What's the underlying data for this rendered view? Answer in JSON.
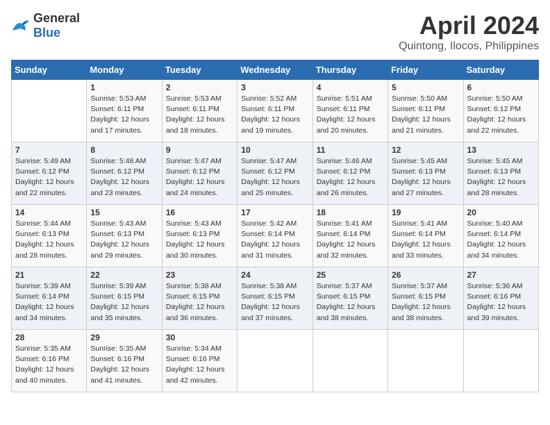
{
  "logo": {
    "general": "General",
    "blue": "Blue"
  },
  "title": "April 2024",
  "subtitle": "Quintong, Ilocos, Philippines",
  "days_of_week": [
    "Sunday",
    "Monday",
    "Tuesday",
    "Wednesday",
    "Thursday",
    "Friday",
    "Saturday"
  ],
  "weeks": [
    [
      {
        "day": "",
        "sunrise": "",
        "sunset": "",
        "daylight": ""
      },
      {
        "day": "1",
        "sunrise": "Sunrise: 5:53 AM",
        "sunset": "Sunset: 6:11 PM",
        "daylight": "Daylight: 12 hours and 17 minutes."
      },
      {
        "day": "2",
        "sunrise": "Sunrise: 5:53 AM",
        "sunset": "Sunset: 6:11 PM",
        "daylight": "Daylight: 12 hours and 18 minutes."
      },
      {
        "day": "3",
        "sunrise": "Sunrise: 5:52 AM",
        "sunset": "Sunset: 6:11 PM",
        "daylight": "Daylight: 12 hours and 19 minutes."
      },
      {
        "day": "4",
        "sunrise": "Sunrise: 5:51 AM",
        "sunset": "Sunset: 6:11 PM",
        "daylight": "Daylight: 12 hours and 20 minutes."
      },
      {
        "day": "5",
        "sunrise": "Sunrise: 5:50 AM",
        "sunset": "Sunset: 6:11 PM",
        "daylight": "Daylight: 12 hours and 21 minutes."
      },
      {
        "day": "6",
        "sunrise": "Sunrise: 5:50 AM",
        "sunset": "Sunset: 6:12 PM",
        "daylight": "Daylight: 12 hours and 22 minutes."
      }
    ],
    [
      {
        "day": "7",
        "sunrise": "Sunrise: 5:49 AM",
        "sunset": "Sunset: 6:12 PM",
        "daylight": "Daylight: 12 hours and 22 minutes."
      },
      {
        "day": "8",
        "sunrise": "Sunrise: 5:48 AM",
        "sunset": "Sunset: 6:12 PM",
        "daylight": "Daylight: 12 hours and 23 minutes."
      },
      {
        "day": "9",
        "sunrise": "Sunrise: 5:47 AM",
        "sunset": "Sunset: 6:12 PM",
        "daylight": "Daylight: 12 hours and 24 minutes."
      },
      {
        "day": "10",
        "sunrise": "Sunrise: 5:47 AM",
        "sunset": "Sunset: 6:12 PM",
        "daylight": "Daylight: 12 hours and 25 minutes."
      },
      {
        "day": "11",
        "sunrise": "Sunrise: 5:46 AM",
        "sunset": "Sunset: 6:12 PM",
        "daylight": "Daylight: 12 hours and 26 minutes."
      },
      {
        "day": "12",
        "sunrise": "Sunrise: 5:45 AM",
        "sunset": "Sunset: 6:13 PM",
        "daylight": "Daylight: 12 hours and 27 minutes."
      },
      {
        "day": "13",
        "sunrise": "Sunrise: 5:45 AM",
        "sunset": "Sunset: 6:13 PM",
        "daylight": "Daylight: 12 hours and 28 minutes."
      }
    ],
    [
      {
        "day": "14",
        "sunrise": "Sunrise: 5:44 AM",
        "sunset": "Sunset: 6:13 PM",
        "daylight": "Daylight: 12 hours and 28 minutes."
      },
      {
        "day": "15",
        "sunrise": "Sunrise: 5:43 AM",
        "sunset": "Sunset: 6:13 PM",
        "daylight": "Daylight: 12 hours and 29 minutes."
      },
      {
        "day": "16",
        "sunrise": "Sunrise: 5:43 AM",
        "sunset": "Sunset: 6:13 PM",
        "daylight": "Daylight: 12 hours and 30 minutes."
      },
      {
        "day": "17",
        "sunrise": "Sunrise: 5:42 AM",
        "sunset": "Sunset: 6:14 PM",
        "daylight": "Daylight: 12 hours and 31 minutes."
      },
      {
        "day": "18",
        "sunrise": "Sunrise: 5:41 AM",
        "sunset": "Sunset: 6:14 PM",
        "daylight": "Daylight: 12 hours and 32 minutes."
      },
      {
        "day": "19",
        "sunrise": "Sunrise: 5:41 AM",
        "sunset": "Sunset: 6:14 PM",
        "daylight": "Daylight: 12 hours and 33 minutes."
      },
      {
        "day": "20",
        "sunrise": "Sunrise: 5:40 AM",
        "sunset": "Sunset: 6:14 PM",
        "daylight": "Daylight: 12 hours and 34 minutes."
      }
    ],
    [
      {
        "day": "21",
        "sunrise": "Sunrise: 5:39 AM",
        "sunset": "Sunset: 6:14 PM",
        "daylight": "Daylight: 12 hours and 34 minutes."
      },
      {
        "day": "22",
        "sunrise": "Sunrise: 5:39 AM",
        "sunset": "Sunset: 6:15 PM",
        "daylight": "Daylight: 12 hours and 35 minutes."
      },
      {
        "day": "23",
        "sunrise": "Sunrise: 5:38 AM",
        "sunset": "Sunset: 6:15 PM",
        "daylight": "Daylight: 12 hours and 36 minutes."
      },
      {
        "day": "24",
        "sunrise": "Sunrise: 5:38 AM",
        "sunset": "Sunset: 6:15 PM",
        "daylight": "Daylight: 12 hours and 37 minutes."
      },
      {
        "day": "25",
        "sunrise": "Sunrise: 5:37 AM",
        "sunset": "Sunset: 6:15 PM",
        "daylight": "Daylight: 12 hours and 38 minutes."
      },
      {
        "day": "26",
        "sunrise": "Sunrise: 5:37 AM",
        "sunset": "Sunset: 6:15 PM",
        "daylight": "Daylight: 12 hours and 38 minutes."
      },
      {
        "day": "27",
        "sunrise": "Sunrise: 5:36 AM",
        "sunset": "Sunset: 6:16 PM",
        "daylight": "Daylight: 12 hours and 39 minutes."
      }
    ],
    [
      {
        "day": "28",
        "sunrise": "Sunrise: 5:35 AM",
        "sunset": "Sunset: 6:16 PM",
        "daylight": "Daylight: 12 hours and 40 minutes."
      },
      {
        "day": "29",
        "sunrise": "Sunrise: 5:35 AM",
        "sunset": "Sunset: 6:16 PM",
        "daylight": "Daylight: 12 hours and 41 minutes."
      },
      {
        "day": "30",
        "sunrise": "Sunrise: 5:34 AM",
        "sunset": "Sunset: 6:16 PM",
        "daylight": "Daylight: 12 hours and 42 minutes."
      },
      {
        "day": "",
        "sunrise": "",
        "sunset": "",
        "daylight": ""
      },
      {
        "day": "",
        "sunrise": "",
        "sunset": "",
        "daylight": ""
      },
      {
        "day": "",
        "sunrise": "",
        "sunset": "",
        "daylight": ""
      },
      {
        "day": "",
        "sunrise": "",
        "sunset": "",
        "daylight": ""
      }
    ]
  ]
}
